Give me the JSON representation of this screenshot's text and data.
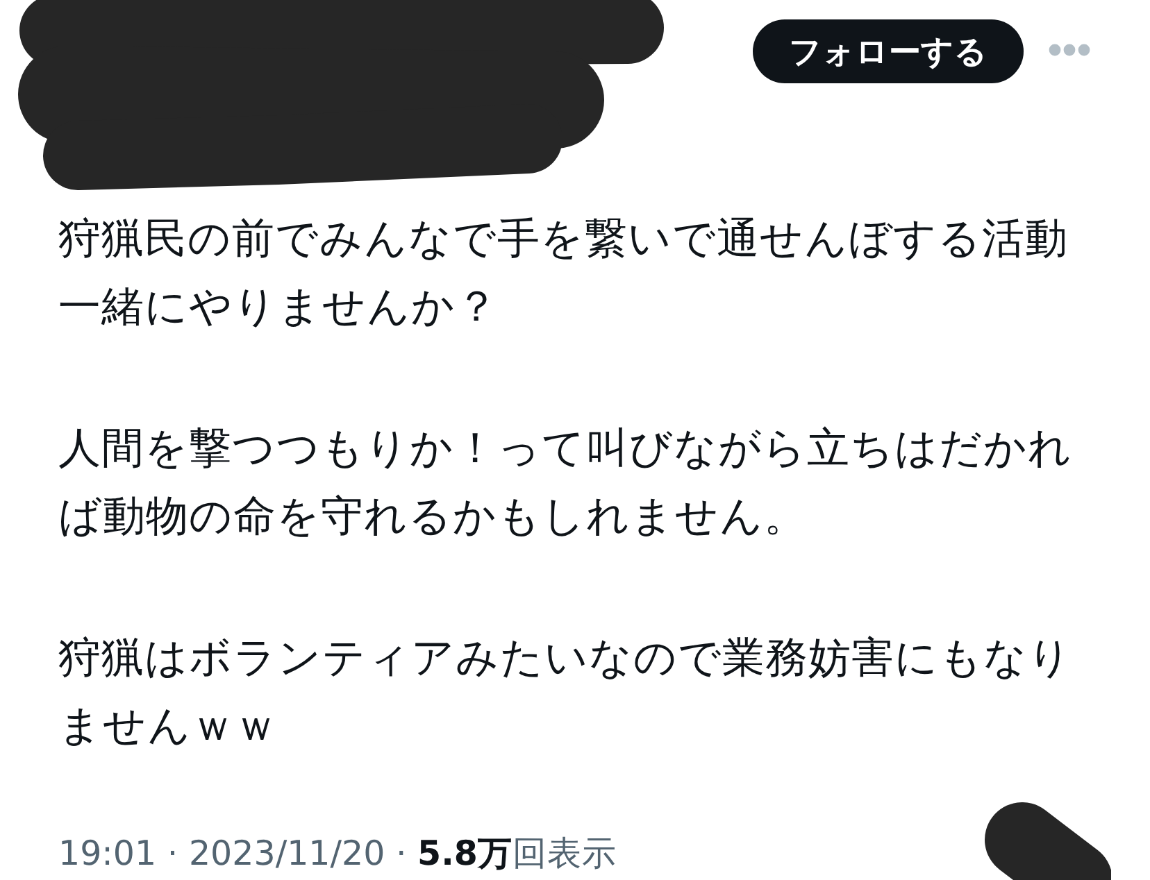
{
  "header": {
    "follow_button": "フォローする"
  },
  "post": {
    "paragraphs": [
      "狩猟民の前でみんなで手を繋いで通せんぼする活動一緒にやりませんか？",
      "人間を撃つつもりか！って叫びながら立ちはだかれば動物の命を守れるかもしれません。",
      "狩猟はボランティアみたいなので業務妨害にもなりませんｗｗ"
    ]
  },
  "meta": {
    "line": "19:01 · 2023/11/20 · **5.8万**回表示"
  }
}
